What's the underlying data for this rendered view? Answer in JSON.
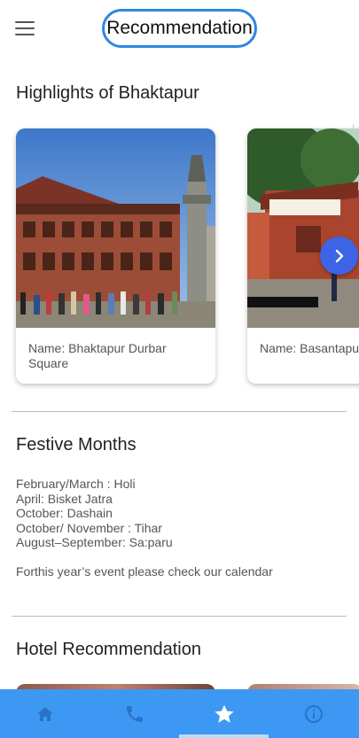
{
  "header": {
    "title": "Recommendation",
    "menu_icon": "menu-icon"
  },
  "highlights": {
    "title": "Highlights of Bhaktapur",
    "cards": [
      {
        "label": "Name: Bhaktapur Durbar Square"
      },
      {
        "label": "Name: Basantapur"
      }
    ],
    "next_icon": "chevron-right-icon"
  },
  "festive": {
    "title": "Festive Months",
    "lines": [
      "February/March : Holi",
      "April: Bisket Jatra",
      "October: Dashain",
      "October/ November : Tihar",
      "August–September: Sa:paru"
    ],
    "note": "Forthis year’s event please check our calendar"
  },
  "hotels": {
    "title": "Hotel Recommendation"
  },
  "bottom_nav": {
    "items": [
      {
        "icon": "home-icon",
        "active": false
      },
      {
        "icon": "phone-icon",
        "active": false
      },
      {
        "icon": "star-icon",
        "active": true
      },
      {
        "icon": "info-icon",
        "active": false
      }
    ],
    "active_color": "#ffffff",
    "inactive_color": "#2a73c4",
    "bar_color": "#3d98f4"
  },
  "colors": {
    "accent": "#2f86e0",
    "fab": "#3d64e6"
  }
}
